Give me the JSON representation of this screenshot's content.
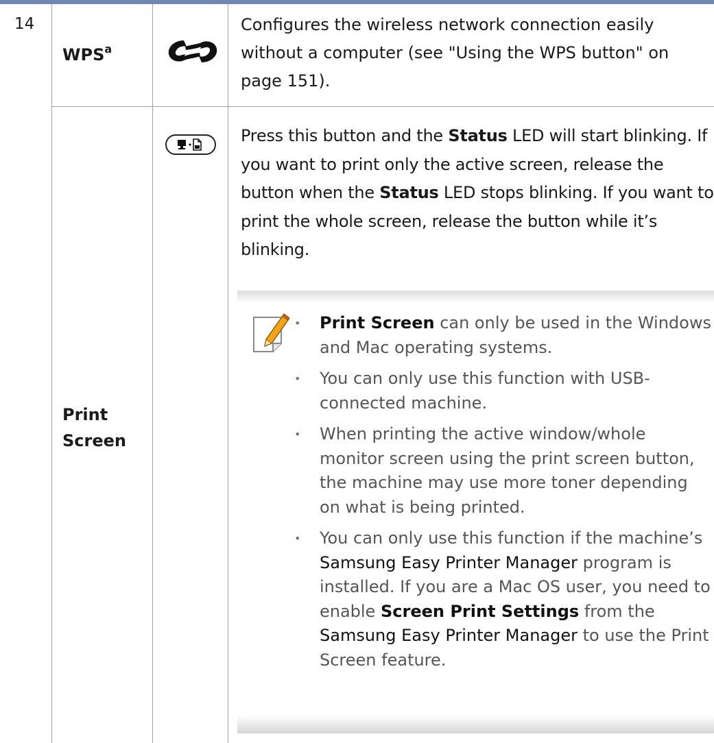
{
  "row_number": "14",
  "wps": {
    "label": "WPS",
    "footnote": "a",
    "icon": "wps-button-icon",
    "description": "Configures the wireless network connection easily without a computer (see \"Using the WPS button\" on page 151)."
  },
  "print_screen": {
    "label_line1": "Print",
    "label_line2": "Screen",
    "icon": "print-screen-button-icon",
    "desc_parts": {
      "a": "Press this button and the ",
      "status1": "Status",
      "b": " LED will start blinking. If you want to print only the active screen, release the button when the ",
      "status2": "Status",
      "c": " LED stops blinking. If you want to print the whole screen, release the button while it’s blinking."
    },
    "note": {
      "icon": "note-pencil-icon",
      "bullet1": {
        "bold": "Print Screen",
        "text": " can only be used in the Windows and Mac operating systems."
      },
      "bullet2": "You can only use this function with USB-connected machine.",
      "bullet3": "When printing the active window/whole monitor screen using the print screen button, the machine may use more toner depending on what is being printed.",
      "bullet4": {
        "a": "You can only use this function if the machine’s ",
        "app1": "Samsung Easy Printer Manager",
        "b": " program is installed. If you are a Mac OS user, you need to enable ",
        "setting": "Screen Print Settings",
        "c": " from the ",
        "app2": "Samsung Easy Printer Manager",
        "d": " to use the Print Screen feature."
      }
    }
  }
}
